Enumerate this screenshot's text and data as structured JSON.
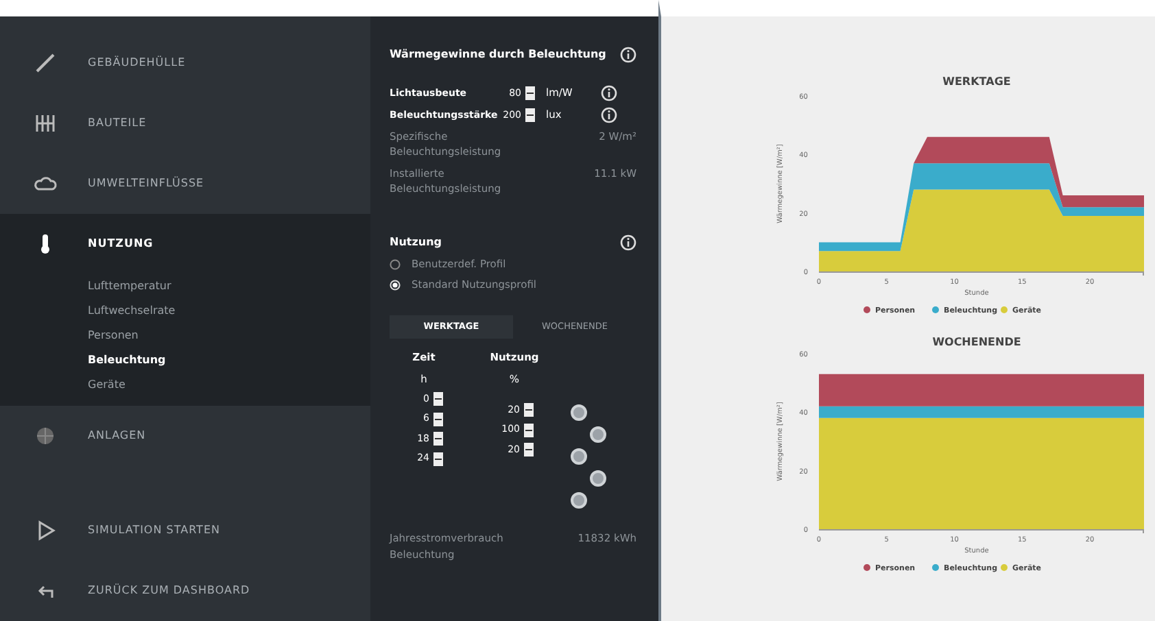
{
  "sidebar": {
    "items": [
      {
        "label": "GEBÄUDEHÜLLE",
        "expanded": false
      },
      {
        "label": "BAUTEILE",
        "expanded": false
      },
      {
        "label": "UMWELTEINFLÜSSE",
        "expanded": false
      },
      {
        "label": "NUTZUNG",
        "expanded": true,
        "children": [
          {
            "label": "Lufttemperatur",
            "selected": false
          },
          {
            "label": "Luftwechselrate",
            "selected": false
          },
          {
            "label": "Personen",
            "selected": false
          },
          {
            "label": "Beleuchtung",
            "selected": true
          },
          {
            "label": "Geräte",
            "selected": false
          }
        ]
      },
      {
        "label": "ANLAGEN",
        "expanded": false
      }
    ],
    "footer": [
      {
        "label": "SIMULATION STARTEN"
      },
      {
        "label": "ZURÜCK ZUM DASHBOARD"
      }
    ]
  },
  "panel": {
    "title": "Wärmegewinne durch Beleuchtung",
    "inputs": [
      {
        "label": "Lichtausbeute",
        "value": "80",
        "unit": "lm/W"
      },
      {
        "label": "Beleuchtungsstärke",
        "value": "200",
        "unit": "lux"
      }
    ],
    "results": [
      {
        "label": "Spezifische Beleuchtungsleistung",
        "value": "2 W/m²"
      },
      {
        "label": "Installierte Beleuchtungsleistung",
        "value": "11.1 kW"
      }
    ],
    "usage": {
      "title": "Nutzung",
      "options": [
        {
          "label": "Benutzerdef. Profil",
          "selected": false
        },
        {
          "label": "Standard Nutzungsprofil",
          "selected": true
        }
      ],
      "tabs": [
        {
          "label": "WERKTAGE",
          "selected": true
        },
        {
          "label": "WOCHENENDE",
          "selected": false
        }
      ],
      "columns": [
        {
          "name": "Zeit",
          "unit": "h"
        },
        {
          "name": "Nutzung",
          "unit": "%"
        }
      ],
      "times": [
        "0",
        "6",
        "18",
        "24"
      ],
      "levels": [
        "20",
        "100",
        "20"
      ]
    },
    "total": {
      "label": "Jahresstromverbrauch Beleuchtung",
      "value": "11832 kWh"
    }
  },
  "charts": [
    {
      "chart_data": {
        "type": "area",
        "title": "WERKTAGE",
        "xlabel": "Stunde",
        "ylabel": "Wärmegewinne [W/m²]",
        "stacked": true,
        "legend": "bottom",
        "x": [
          0,
          1,
          2,
          3,
          4,
          5,
          6,
          7,
          8,
          9,
          10,
          11,
          12,
          13,
          14,
          15,
          16,
          17,
          18,
          19,
          20,
          21,
          22,
          23,
          24
        ],
        "xlim": [
          0,
          24
        ],
        "ylim": [
          0,
          60
        ],
        "xticks": [
          0,
          5,
          10,
          15,
          20
        ],
        "yticks": [
          0,
          20,
          40,
          60
        ],
        "series": [
          {
            "name": "Geräte",
            "color": "#d8cc3c",
            "values": [
              7,
              7,
              7,
              7,
              7,
              7,
              7,
              28,
              28,
              28,
              28,
              28,
              28,
              28,
              28,
              28,
              28,
              28,
              19,
              19,
              19,
              19,
              19,
              19,
              19
            ]
          },
          {
            "name": "Beleuchtung",
            "color": "#3aaccb",
            "values": [
              3,
              3,
              3,
              3,
              3,
              3,
              3,
              9,
              9,
              9,
              9,
              9,
              9,
              9,
              9,
              9,
              9,
              9,
              3,
              3,
              3,
              3,
              3,
              3,
              3
            ]
          },
          {
            "name": "Personen",
            "color": "#b24a5a",
            "values": [
              0,
              0,
              0,
              0,
              0,
              0,
              0,
              0,
              9,
              9,
              9,
              9,
              9,
              9,
              9,
              9,
              9,
              9,
              4,
              4,
              4,
              4,
              4,
              4,
              4
            ]
          }
        ]
      }
    },
    {
      "chart_data": {
        "type": "area",
        "title": "WOCHENENDE",
        "xlabel": "Stunde",
        "ylabel": "Wärmegewinne [W/m²]",
        "stacked": true,
        "legend": "bottom",
        "x": [
          0,
          24
        ],
        "xlim": [
          0,
          24
        ],
        "ylim": [
          0,
          60
        ],
        "xticks": [
          0,
          5,
          10,
          15,
          20
        ],
        "yticks": [
          0,
          20,
          40,
          60
        ],
        "series": [
          {
            "name": "Geräte",
            "color": "#d8cc3c",
            "values": [
              38,
              38
            ]
          },
          {
            "name": "Beleuchtung",
            "color": "#3aaccb",
            "values": [
              4,
              4
            ]
          },
          {
            "name": "Personen",
            "color": "#b24a5a",
            "values": [
              11,
              11
            ]
          }
        ]
      }
    }
  ]
}
